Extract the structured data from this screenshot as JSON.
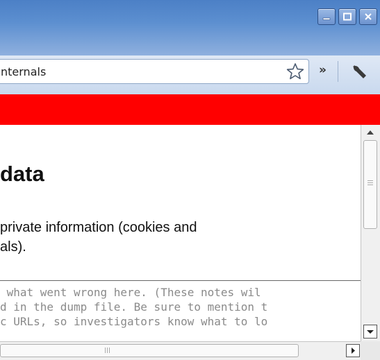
{
  "window": {
    "controls": [
      {
        "name": "minimize-icon"
      },
      {
        "name": "maximize-icon"
      },
      {
        "name": "close-icon"
      }
    ]
  },
  "toolbar": {
    "address_text": "nternals",
    "bookmark_icon": "star-icon",
    "overflow_label": "»",
    "menu_icon": "wrench-icon"
  },
  "banner": {
    "color": "#ff0000"
  },
  "page": {
    "heading": "data",
    "paragraph_line1": "private information (cookies and",
    "paragraph_line2": "als)."
  },
  "notes": {
    "line1": " what went wrong here. (These notes wil",
    "line2": "d in the dump file. Be sure to mention t",
    "line3": "c URLs, so investigators know what to lo"
  }
}
